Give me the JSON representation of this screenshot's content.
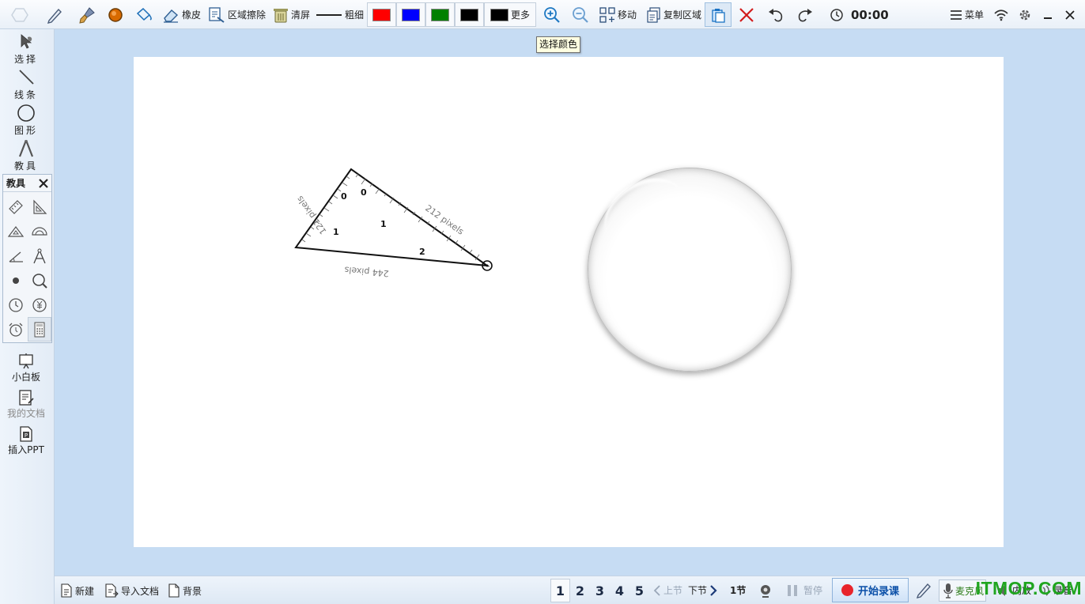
{
  "toolbar": {
    "eraser_label": "橡皮",
    "area_erase_label": "区域擦除",
    "clear_label": "清屏",
    "thickness_label": "粗细",
    "more_label": "更多",
    "move_label": "移动",
    "copy_area_label": "复制区域",
    "timer": "00:00",
    "menu_label": "菜单",
    "colors": [
      "#ff0000",
      "#0000ff",
      "#008000",
      "#000000",
      "#000000"
    ]
  },
  "tooltip": "选择颜色",
  "left_tools": [
    {
      "label": "选择",
      "icon": "select-icon"
    },
    {
      "label": "线条",
      "icon": "line-icon"
    },
    {
      "label": "图形",
      "icon": "shape-icon"
    },
    {
      "label": "教具",
      "icon": "compass-icon"
    }
  ],
  "teaching_panel": {
    "title": "教具",
    "tools": [
      "ruler-icon",
      "set-square-icon",
      "triangle-ruler-icon",
      "protractor-icon",
      "angle-icon",
      "compass-icon",
      "dot-icon",
      "magnifier-icon",
      "clock-icon",
      "currency-icon",
      "alarm-icon",
      "calculator-icon"
    ]
  },
  "left_bottom": [
    {
      "label": "小白板",
      "icon": "whiteboard-icon",
      "enabled": true
    },
    {
      "label": "我的文档",
      "icon": "documents-icon",
      "enabled": false
    },
    {
      "label": "插入PPT",
      "icon": "ppt-icon",
      "enabled": true
    }
  ],
  "canvas": {
    "triangle": {
      "side_a": "121 pixels",
      "side_b": "212 pixels",
      "side_c": "244 pixels",
      "tick_labels": [
        "0",
        "1",
        "0",
        "1",
        "2"
      ]
    }
  },
  "bottom": {
    "new_label": "新建",
    "import_label": "导入文档",
    "background_label": "背景",
    "pages": [
      "1",
      "2",
      "3",
      "4",
      "5"
    ],
    "current_page": "1",
    "prev_label": "上节",
    "next_label": "下节",
    "section_label": "1节",
    "pause_label": "暂停",
    "record_label": "开始录课",
    "mic_label": "麦克风",
    "speaker_label": "内放",
    "sound_label": "录音"
  },
  "watermark": "ITMOP.COM"
}
